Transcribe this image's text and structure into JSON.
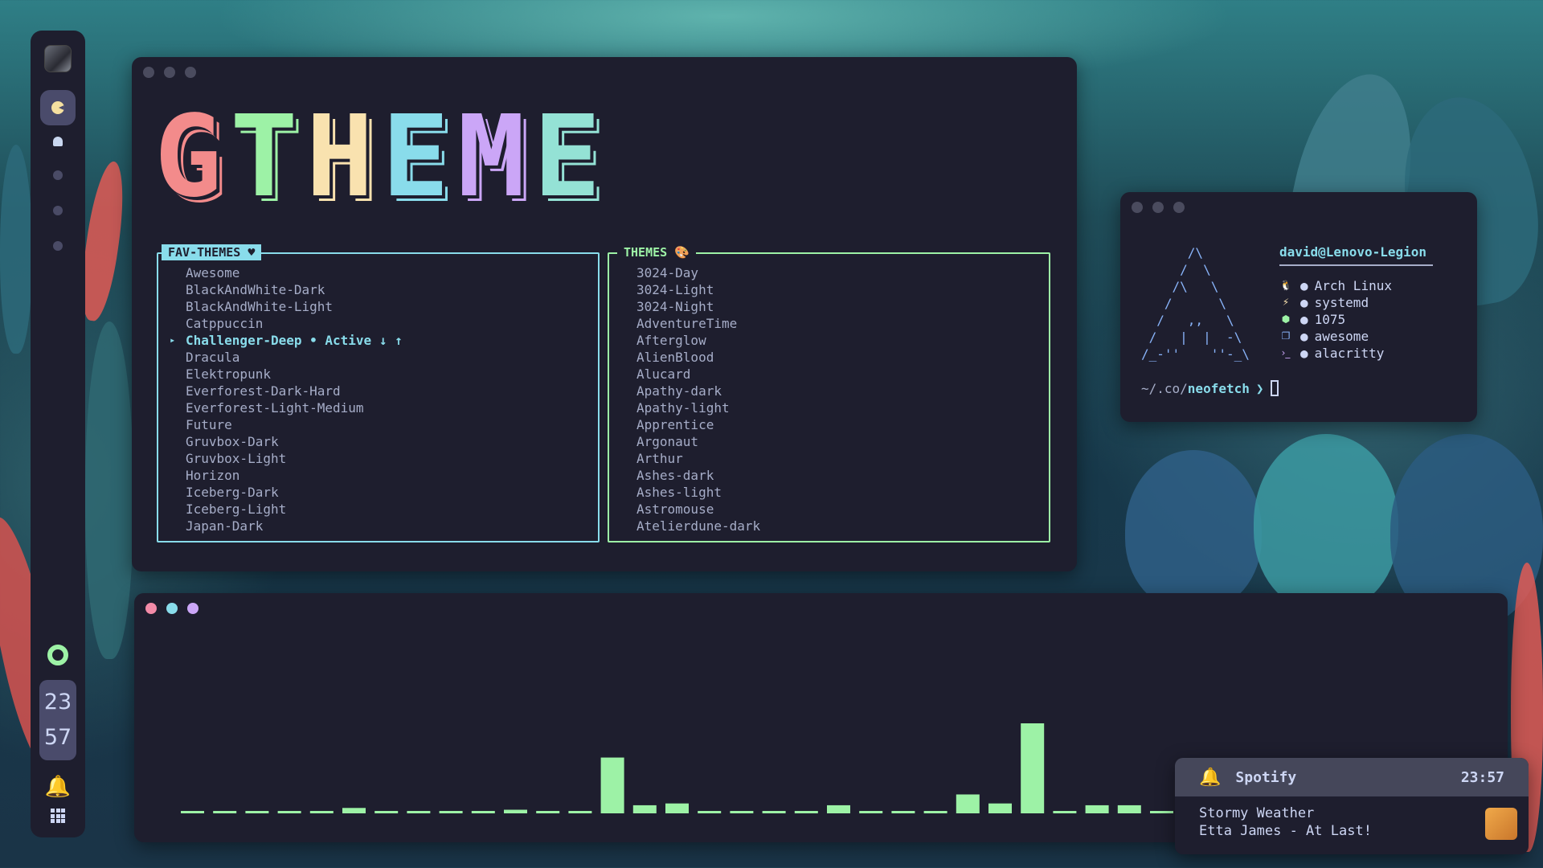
{
  "sidebar": {
    "clock": {
      "hour": "23",
      "minute": "57"
    }
  },
  "logo": {
    "letters": [
      {
        "char": "G",
        "color": "#f38b8b"
      },
      {
        "char": "T",
        "color": "#9df2a6"
      },
      {
        "char": "H",
        "color": "#f9e2af"
      },
      {
        "char": "E",
        "color": "#89dceb"
      },
      {
        "char": "M",
        "color": "#cba6f7"
      },
      {
        "char": "E",
        "color": "#94e2d5"
      }
    ]
  },
  "fav_themes": {
    "title": "FAV-THEMES ♥",
    "items": [
      "Awesome",
      "BlackAndWhite-Dark",
      "BlackAndWhite-Light",
      "Catppuccin",
      "Challenger-Deep • Active ↓ ↑",
      "Dracula",
      "Elektropunk",
      "Everforest-Dark-Hard",
      "Everforest-Light-Medium",
      "Future",
      "Gruvbox-Dark",
      "Gruvbox-Light",
      "Horizon",
      "Iceberg-Dark",
      "Iceberg-Light",
      "Japan-Dark"
    ]
  },
  "themes": {
    "title": "THEMES 🎨",
    "items": [
      "3024-Day",
      "3024-Light",
      "3024-Night",
      "AdventureTime",
      "Afterglow",
      "AlienBlood",
      "Alucard",
      "Apathy-dark",
      "Apathy-light",
      "Apprentice",
      "Argonaut",
      "Arthur",
      "Ashes-dark",
      "Ashes-light",
      "Astromouse",
      "Atelierdune-dark"
    ]
  },
  "neofetch": {
    "ascii": "      /\\\n     /  \\\n    /\\   \\\n   /      \\\n  /   ,,   \\\n /   |  |  -\\\n/_-''    ''-_\\",
    "user": "david@Lenovo-Legion",
    "info": [
      {
        "icon": "linux-icon",
        "glyph": "🐧",
        "color": "#f38ba8",
        "text": "Arch Linux"
      },
      {
        "icon": "init-icon",
        "glyph": "⚡",
        "color": "#f9e2af",
        "text": "systemd"
      },
      {
        "icon": "package-icon",
        "glyph": "⬢",
        "color": "#9df2a6",
        "text": "1075"
      },
      {
        "icon": "window-icon",
        "glyph": "❐",
        "color": "#89b4fa",
        "text": "awesome"
      },
      {
        "icon": "terminal-icon",
        "glyph": "›_",
        "color": "#cba6f7",
        "text": "alacritty"
      }
    ],
    "bullet": "●",
    "prompt": {
      "dim": "~/.co/",
      "highlight": "neofetch",
      "arrow": "❯"
    }
  },
  "visualizer": {
    "color": "#9df2a6",
    "levels": [
      0.02,
      0.02,
      0.02,
      0.02,
      0.02,
      0.06,
      0.02,
      0.02,
      0.02,
      0.02,
      0.04,
      0.02,
      0.02,
      0.62,
      0.09,
      0.11,
      0.02,
      0.02,
      0.02,
      0.02,
      0.09,
      0.02,
      0.02,
      0.02,
      0.21,
      0.11,
      1.0,
      0.02,
      0.09,
      0.09,
      0.02
    ]
  },
  "notification": {
    "app": "Spotify",
    "time": "23:57",
    "title": "Stormy Weather",
    "subtitle": "Etta James - At Last!"
  }
}
